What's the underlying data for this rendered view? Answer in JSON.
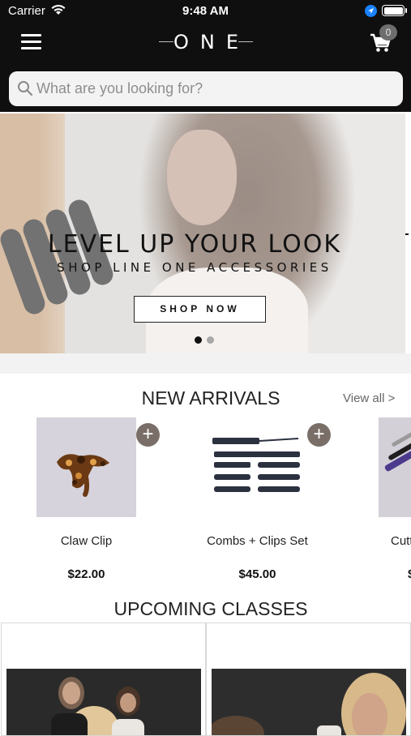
{
  "status_bar": {
    "carrier": "Carrier",
    "time": "9:48 AM"
  },
  "header": {
    "logo_text": "ONE",
    "cart_count": "0"
  },
  "search": {
    "placeholder": "What are you looking for?"
  },
  "hero": {
    "headline": "LEVEL UP YOUR LOOK",
    "subline": "SHOP LINE ONE ACCESSORIES",
    "button_label": "SHOP NOW",
    "active_slide": 1,
    "slide_count": 2
  },
  "new_arrivals": {
    "title": "NEW ARRIVALS",
    "view_all": "View all >",
    "products": [
      {
        "name": "Claw Clip",
        "price": "$22.00"
      },
      {
        "name": "Combs + Clips Set",
        "price": "$45.00"
      },
      {
        "name": "Cutt",
        "price": "$"
      }
    ]
  },
  "upcoming_classes": {
    "title": "UPCOMING CLASSES"
  }
}
